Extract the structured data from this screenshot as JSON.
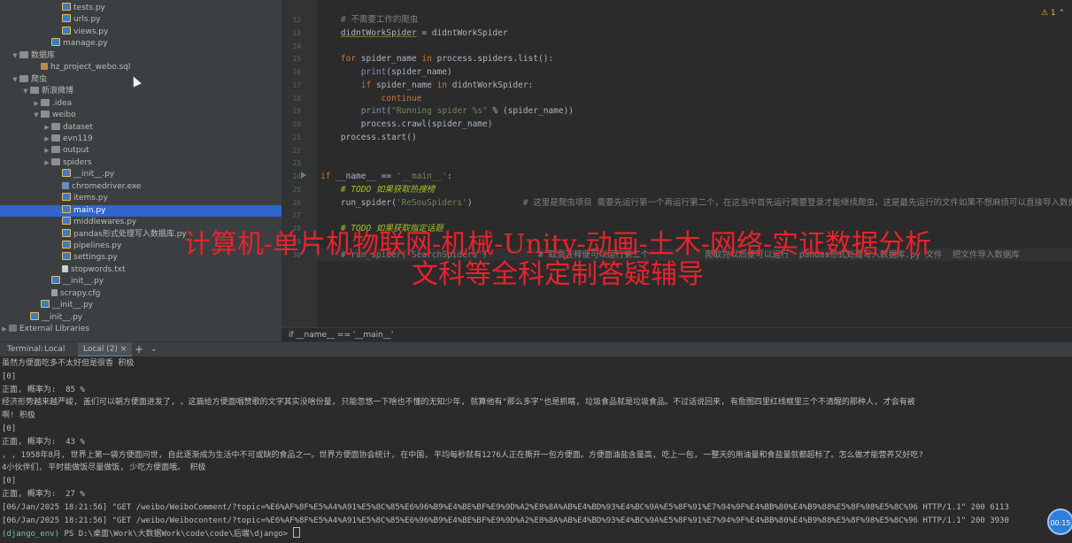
{
  "tree": [
    {
      "label": "tests.py",
      "type": "py",
      "indent": 60,
      "arrow": ""
    },
    {
      "label": "urls.py",
      "type": "py",
      "indent": 60,
      "arrow": ""
    },
    {
      "label": "views.py",
      "type": "py",
      "indent": 60,
      "arrow": ""
    },
    {
      "label": "manage.py",
      "type": "py",
      "indent": 48,
      "arrow": ""
    },
    {
      "label": "数据库",
      "type": "folder",
      "indent": 12,
      "arrow": "▼"
    },
    {
      "label": "hz_project_webo.sql",
      "type": "sql",
      "indent": 36,
      "arrow": ""
    },
    {
      "label": "爬虫",
      "type": "folder",
      "indent": 12,
      "arrow": "▼"
    },
    {
      "label": "新浪微博",
      "type": "folder",
      "indent": 24,
      "arrow": "▼"
    },
    {
      "label": ".idea",
      "type": "folder",
      "indent": 36,
      "arrow": "▶"
    },
    {
      "label": "weibo",
      "type": "folder",
      "indent": 36,
      "arrow": "▼"
    },
    {
      "label": "dataset",
      "type": "folder",
      "indent": 48,
      "arrow": "▶"
    },
    {
      "label": "evn119",
      "type": "folder",
      "indent": 48,
      "arrow": "▶"
    },
    {
      "label": "output",
      "type": "folder",
      "indent": 48,
      "arrow": "▶"
    },
    {
      "label": "spiders",
      "type": "folder",
      "indent": 48,
      "arrow": "▶"
    },
    {
      "label": "__init__.py",
      "type": "py",
      "indent": 60,
      "arrow": ""
    },
    {
      "label": "chromedriver.exe",
      "type": "exe",
      "indent": 60,
      "arrow": ""
    },
    {
      "label": "items.py",
      "type": "py",
      "indent": 60,
      "arrow": ""
    },
    {
      "label": "main.py",
      "type": "py",
      "indent": 60,
      "arrow": "",
      "selected": true
    },
    {
      "label": "middlewares.py",
      "type": "py",
      "indent": 60,
      "arrow": ""
    },
    {
      "label": "pandas形式处理写入数据库.py",
      "type": "py",
      "indent": 60,
      "arrow": ""
    },
    {
      "label": "pipelines.py",
      "type": "py",
      "indent": 60,
      "arrow": ""
    },
    {
      "label": "settings.py",
      "type": "py",
      "indent": 60,
      "arrow": ""
    },
    {
      "label": "stopwords.txt",
      "type": "file",
      "indent": 60,
      "arrow": ""
    },
    {
      "label": "__init__.py",
      "type": "py",
      "indent": 48,
      "arrow": ""
    },
    {
      "label": "scrapy.cfg",
      "type": "cfg",
      "indent": 48,
      "arrow": ""
    },
    {
      "label": "__init__.py",
      "type": "py",
      "indent": 36,
      "arrow": ""
    },
    {
      "label": "__init__.py",
      "type": "py",
      "indent": 24,
      "arrow": ""
    },
    {
      "label": "External Libraries",
      "type": "lib",
      "indent": 0,
      "arrow": "▶"
    }
  ],
  "editor": {
    "warning": "⚠ 1 ⌃",
    "breadcrumb": "if __name__ == '__main__'",
    "lines": [
      {
        "n": "12",
        "html": "    <span class='cm'># 不需要工作的爬虫</span>"
      },
      {
        "n": "13",
        "html": "    <span style='text-decoration:underline;text-decoration-color:#6f7a3a'>didntWorkSpider</span> = didntWorkSpider"
      },
      {
        "n": "14",
        "html": ""
      },
      {
        "n": "15",
        "html": "    <span class='kw'>for</span> spider_name <span class='kw'>in</span> process.spiders.list():"
      },
      {
        "n": "16",
        "html": "        <span class='bi'>print</span>(spider_name)"
      },
      {
        "n": "17",
        "html": "        <span class='kw'>if</span> spider_name <span class='kw'>in</span> didntWorkSpider:"
      },
      {
        "n": "18",
        "html": "            <span class='kw'>continue</span>"
      },
      {
        "n": "19",
        "html": "        <span class='bi'>print</span>(<span class='str'>\"Running spider %s\"</span> % (spider_name))"
      },
      {
        "n": "20",
        "html": "        process.crawl(spider_name)"
      },
      {
        "n": "21",
        "html": "    process.start()"
      },
      {
        "n": "22",
        "html": ""
      },
      {
        "n": "23",
        "html": ""
      },
      {
        "n": "24",
        "html": "<span class='kw'>if</span> __name__ == <span class='str'>'__main__'</span>:"
      },
      {
        "n": "25",
        "html": "    <span class='todo'># TODO 如果获取热搜榜</span>"
      },
      {
        "n": "26",
        "html": "    run_spider(<span class='str'>'ReSouSpiders'</span>)          <span class='cm'># 这里是爬虫项目 需要先运行第一个再运行第二个，在这当中首先运行需要登录才能继续爬虫，这是最先运行的文件如果不想麻烦可以直接导入数据库当中的数据</span>"
      },
      {
        "n": "27",
        "html": ""
      },
      {
        "n": "28",
        "html": "    <span class='todo'># TODO 如果获取指定话题</span>"
      },
      {
        "n": "29",
        "html": ""
      },
      {
        "n": "30",
        "html": "    <span class='cm'># run_spider('SearchSpiders')          # 取消注释便可以运行第二个           爬取完以后便可以运行  pandas形式处理写入数据库.py 文件  把文件导入数据库</span>"
      }
    ]
  },
  "overlay": {
    "line1": "计算机-单片机物联网-机械-Unity-动画-土木-网络-实证数据分析",
    "line2": "文科等全科定制答疑辅导"
  },
  "terminal": {
    "label": "Terminal:",
    "tab1": "Local",
    "tab2": "Local (2)",
    "add": "+",
    "more": "⌄",
    "lines": [
      "虽然方便面吃多不太好但是很香 积极",
      "[0]",
      "正面, 概率为:  85 %",
      "经济形势越来越严峻, 盖们可以朝方便面进发了, 。这篇给方便面唱赞歌的文字其实没啥份量, 只能忽悠一下啥也不懂的无知少年, 就算他有\"那么多字\"也是抓瞎, 垃圾食品就是垃圾食品。不过话说回来, 有詹图四里红线框里三个不清醒的那种人, 才会有被",
      "啊! 积极",
      "[0]",
      "正面, 概率为:  43 %",
      ", , 1958年8月, 世界上第一袋方便面问世, 自此逐渐成为生活中不可或缺的食品之一。世界方便面协会统计, 在中国, 平均每秒就有1276人正在撕开一包方便面。方便面油盐含量高, 吃上一包, 一整天的用油量和食盐量就都超标了。怎么做才能营养又好吃?",
      "4小伙伴们, 平时能做饭尽量做饭, 少吃方便面哦。 积极",
      "[0]",
      "正面, 概率为:  27 %",
      "[06/Jan/2025 18:21:56] \"GET /weibo/WeiboComment/?topic=%E6%AF%8F%E5%A4%A91%E5%8C%85%E6%96%B9%E4%BE%BF%E9%9D%A2%E8%8A%AB%E4%BD%93%E4%BC%9A%E5%8F%91%E7%94%9F%E4%BB%80%E4%B9%88%E5%8F%98%E5%8C%96 HTTP/1.1\" 200 6113",
      "[06/Jan/2025 18:21:56] \"GET /weibo/Weibocontent/?topic=%E6%AF%8F%E5%A4%A91%E5%8C%85%E6%96%B9%E4%BE%BF%E9%9D%A2%E8%8A%AB%E4%BD%93%E4%BC%9A%E5%8F%91%E7%94%9F%E4%BB%80%E4%B9%88%E5%8F%98%E5%8C%96 HTTP/1.1\" 200 3930"
    ],
    "prompt_env": "(django_env)",
    "prompt_path": " PS D:\\桌面\\Work\\大数据Work\\code\\code\\后端\\django> "
  },
  "badge": "00:15"
}
